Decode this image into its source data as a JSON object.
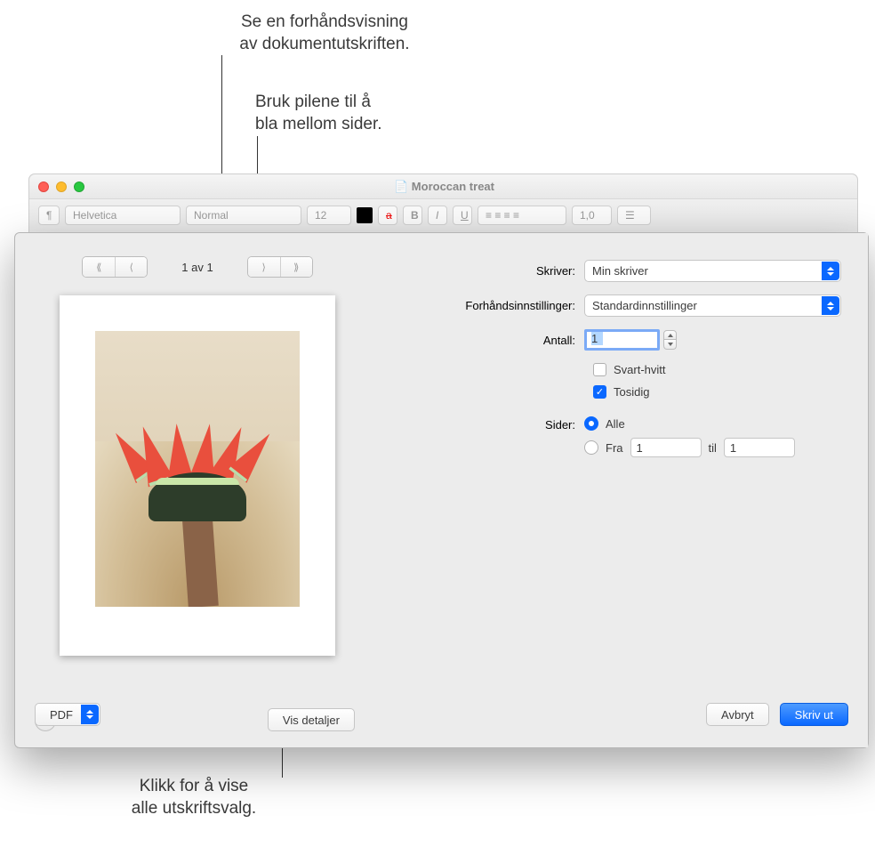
{
  "callouts": {
    "preview": "Se en forhåndsvisning\nav dokumentutskriften.",
    "arrows": "Bruk pilene til å\nbla mellom sider.",
    "details": "Klikk for å vise\nalle utskriftsvalg."
  },
  "window": {
    "title": "Moroccan treat",
    "toolbar": {
      "font": "Helvetica",
      "style": "Normal",
      "size": "12",
      "spacing": "1,0"
    }
  },
  "preview": {
    "page_indicator": "1 av 1"
  },
  "settings": {
    "printer_label": "Skriver:",
    "printer_value": "Min skriver",
    "presets_label": "Forhåndsinnstillinger:",
    "presets_value": "Standardinnstillinger",
    "copies_label": "Antall:",
    "copies_value": "1",
    "bw_label": "Svart-hvitt",
    "twosided_label": "Tosidig",
    "pages_label": "Sider:",
    "pages_all": "Alle",
    "pages_from": "Fra",
    "pages_from_value": "1",
    "pages_to": "til",
    "pages_to_value": "1"
  },
  "footer": {
    "details": "Vis detaljer",
    "pdf": "PDF",
    "cancel": "Avbryt",
    "print": "Skriv ut"
  }
}
